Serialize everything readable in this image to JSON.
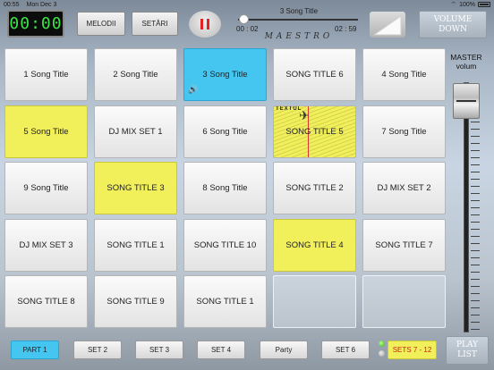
{
  "status_bar": {
    "time": "00:55",
    "date": "Mon Dec 3",
    "battery": "100%"
  },
  "timer": "00:00",
  "top_buttons": {
    "melodii": "MELODII",
    "setari": "SETĂRI"
  },
  "player": {
    "title": "3 Song Title",
    "elapsed": "00 : 02",
    "remaining": "02 : 59",
    "progress": 0.02,
    "brand": "MAESTRO"
  },
  "volume_down": "VOLUME DOWN",
  "master": {
    "label": "MASTER volum",
    "level": 0.97
  },
  "pads": [
    {
      "label": "1 Song Title",
      "color": "white"
    },
    {
      "label": "2 Song Title",
      "color": "white"
    },
    {
      "label": "3 Song Title",
      "color": "cyan",
      "playing": true
    },
    {
      "label": "SONG TITLE 6",
      "color": "white"
    },
    {
      "label": "4 Song Title",
      "color": "white"
    },
    {
      "label": "5 Song Title",
      "color": "yellow"
    },
    {
      "label": "DJ MIX SET 1",
      "color": "white"
    },
    {
      "label": "6 Song Title",
      "color": "white"
    },
    {
      "label": "SONG TITLE 5",
      "color": "art",
      "art_text": "TEXTUL"
    },
    {
      "label": "7 Song Title",
      "color": "white"
    },
    {
      "label": "9 Song Title",
      "color": "white"
    },
    {
      "label": "SONG TITLE 3",
      "color": "yellow"
    },
    {
      "label": "8 Song Title",
      "color": "white"
    },
    {
      "label": "SONG TITLE 2",
      "color": "white"
    },
    {
      "label": "DJ MIX SET 2",
      "color": "white"
    },
    {
      "label": "DJ MIX SET 3",
      "color": "white"
    },
    {
      "label": "SONG TITLE 1",
      "color": "white"
    },
    {
      "label": "SONG TITLE 10",
      "color": "white"
    },
    {
      "label": "SONG TITLE 4",
      "color": "yellow"
    },
    {
      "label": "SONG TITLE 7",
      "color": "white"
    },
    {
      "label": "SONG TITLE 8",
      "color": "white"
    },
    {
      "label": "SONG TITLE 9",
      "color": "white"
    },
    {
      "label": "SONG TITLE 1",
      "color": "white"
    },
    {
      "label": "",
      "color": "empty"
    },
    {
      "label": "",
      "color": "empty"
    }
  ],
  "sets": {
    "buttons": [
      "PART 1",
      "SET 2",
      "SET 3",
      "SET 4",
      "Party",
      "SET 6"
    ],
    "active_index": 0,
    "sets_range": "SETS 7 - 12"
  },
  "playlist": "PLAY LIST",
  "colors": {
    "accent_cyan": "#45c6f1",
    "pad_yellow": "#f1ef5a",
    "timer_green": "#3be24a",
    "pause_red": "#e52222"
  }
}
